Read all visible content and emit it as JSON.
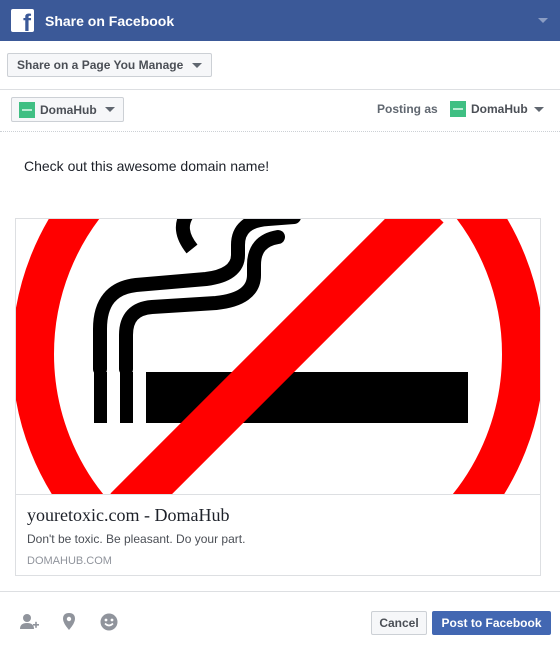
{
  "dialog": {
    "title": "Share on Facebook"
  },
  "share_target": {
    "selected": "Share on a Page You Manage"
  },
  "page_selector": {
    "selected_page": "DomaHub",
    "posting_as_label": "Posting as",
    "posting_as_page": "DomaHub"
  },
  "message": {
    "text": "Check out this awesome domain name!"
  },
  "link_preview": {
    "title": "youretoxic.com - DomaHub",
    "description": "Don't be toxic. Be pleasant. Do your part.",
    "domain": "DOMAHUB.COM",
    "image_icon": "no-smoking-sign"
  },
  "footer": {
    "icons": [
      "tag-friends-icon",
      "location-icon",
      "feeling-icon"
    ],
    "cancel_label": "Cancel",
    "post_label": "Post to Facebook"
  },
  "colors": {
    "brand_blue": "#3b5998",
    "button_blue": "#4267b2",
    "page_avatar_green": "#3fbf83",
    "prohibition_red": "#ff0000"
  }
}
